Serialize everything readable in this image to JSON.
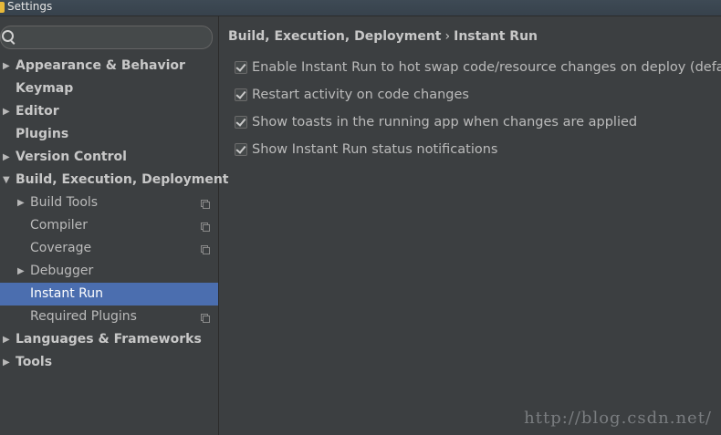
{
  "window": {
    "title": "Settings"
  },
  "search": {
    "value": "",
    "placeholder": ""
  },
  "tree": [
    {
      "label": "Appearance & Behavior",
      "level": 0,
      "expandable": true,
      "expanded": false,
      "bold": true,
      "copy": false,
      "selected": false
    },
    {
      "label": "Keymap",
      "level": 0,
      "expandable": false,
      "expanded": false,
      "bold": true,
      "copy": false,
      "selected": false
    },
    {
      "label": "Editor",
      "level": 0,
      "expandable": true,
      "expanded": false,
      "bold": true,
      "copy": false,
      "selected": false
    },
    {
      "label": "Plugins",
      "level": 0,
      "expandable": false,
      "expanded": false,
      "bold": true,
      "copy": false,
      "selected": false
    },
    {
      "label": "Version Control",
      "level": 0,
      "expandable": true,
      "expanded": false,
      "bold": true,
      "copy": false,
      "selected": false
    },
    {
      "label": "Build, Execution, Deployment",
      "level": 0,
      "expandable": true,
      "expanded": true,
      "bold": true,
      "copy": false,
      "selected": false
    },
    {
      "label": "Build Tools",
      "level": 1,
      "expandable": true,
      "expanded": false,
      "bold": false,
      "copy": true,
      "selected": false
    },
    {
      "label": "Compiler",
      "level": 1,
      "expandable": false,
      "expanded": false,
      "bold": false,
      "copy": true,
      "selected": false
    },
    {
      "label": "Coverage",
      "level": 1,
      "expandable": false,
      "expanded": false,
      "bold": false,
      "copy": true,
      "selected": false
    },
    {
      "label": "Debugger",
      "level": 1,
      "expandable": true,
      "expanded": false,
      "bold": false,
      "copy": false,
      "selected": false
    },
    {
      "label": "Instant Run",
      "level": 1,
      "expandable": false,
      "expanded": false,
      "bold": false,
      "copy": false,
      "selected": true
    },
    {
      "label": "Required Plugins",
      "level": 1,
      "expandable": false,
      "expanded": false,
      "bold": false,
      "copy": true,
      "selected": false
    },
    {
      "label": "Languages & Frameworks",
      "level": 0,
      "expandable": true,
      "expanded": false,
      "bold": true,
      "copy": false,
      "selected": false
    },
    {
      "label": "Tools",
      "level": 0,
      "expandable": true,
      "expanded": false,
      "bold": true,
      "copy": false,
      "selected": false
    }
  ],
  "breadcrumb": {
    "parent": "Build, Execution, Deployment",
    "separator": "›",
    "current": "Instant Run"
  },
  "options": [
    {
      "label": "Enable Instant Run to hot swap code/resource changes on deploy (defau",
      "checked": true
    },
    {
      "label": "Restart activity on code changes",
      "checked": true
    },
    {
      "label": "Show toasts in the running app when changes are applied",
      "checked": true
    },
    {
      "label": "Show Instant Run status notifications",
      "checked": true
    }
  ],
  "watermark": "http://blog.csdn.net/",
  "colors": {
    "selection": "#4b6eaf",
    "background": "#3c3f41"
  }
}
